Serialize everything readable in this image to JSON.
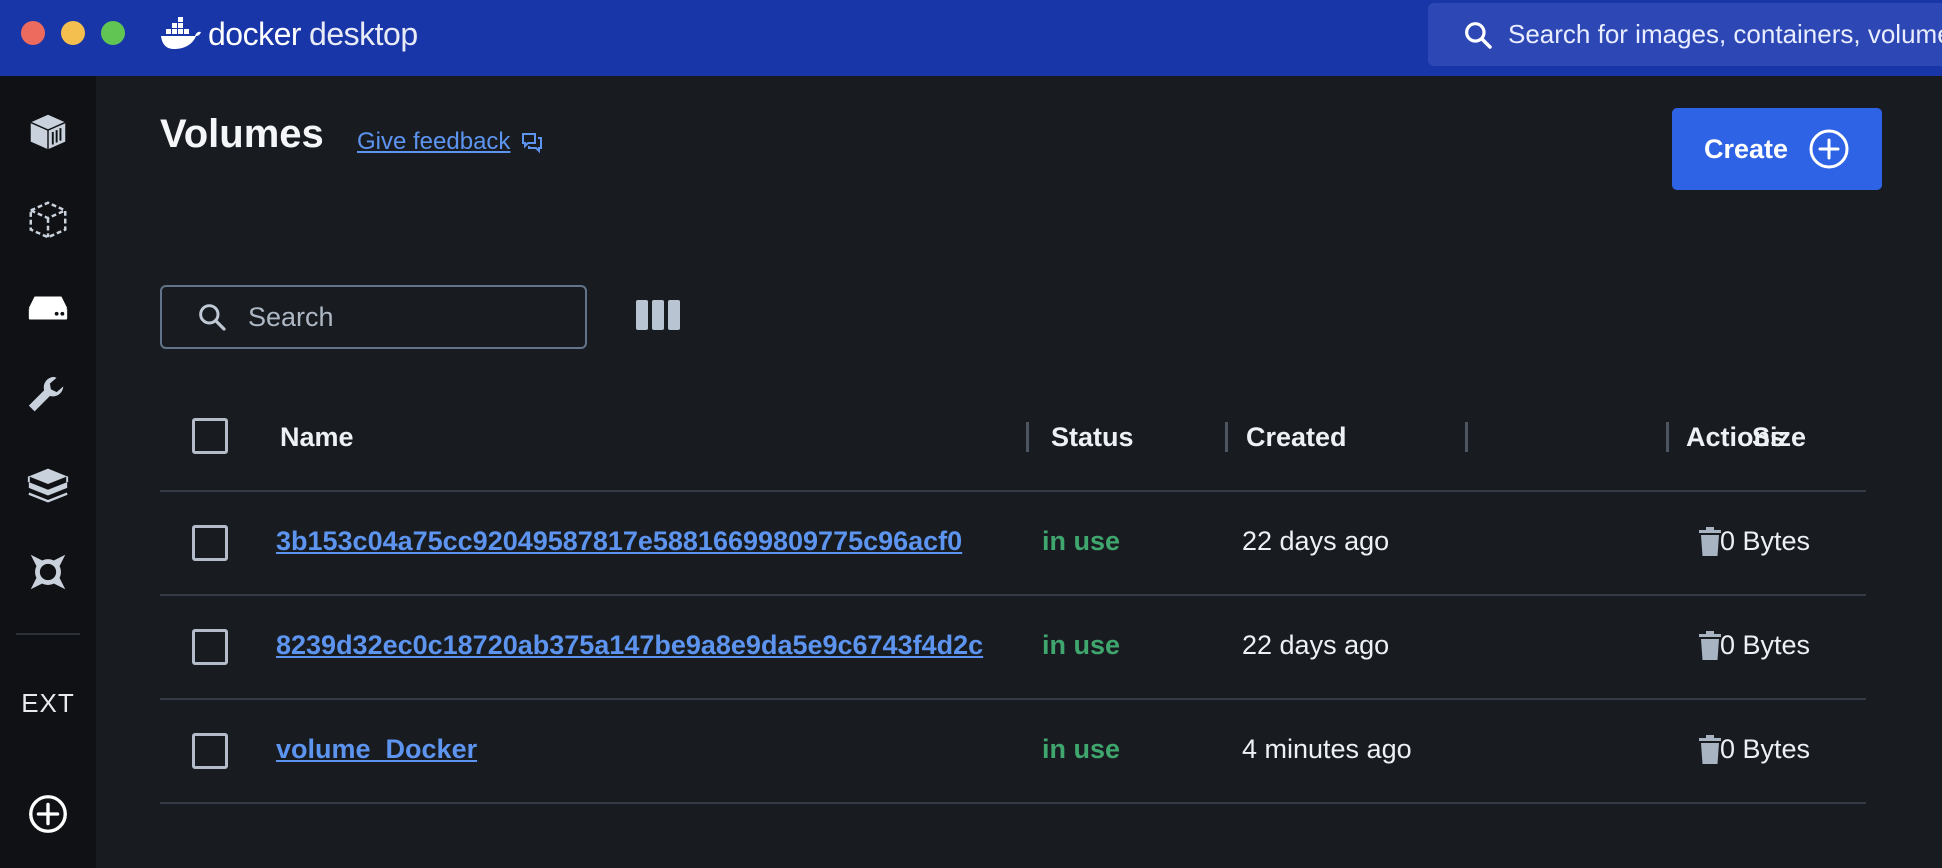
{
  "titlebar": {
    "brand_primary": "docker",
    "brand_secondary": "desktop",
    "search_placeholder": "Search for images, containers, volumes",
    "brand_color": "#1836a8"
  },
  "sidebar": {
    "items": [
      {
        "name": "containers",
        "icon": "container-icon"
      },
      {
        "name": "images",
        "icon": "image-icon"
      },
      {
        "name": "volumes",
        "icon": "volume-icon"
      },
      {
        "name": "dev-environments",
        "icon": "wrench-icon"
      },
      {
        "name": "docker-scout",
        "icon": "cube-icon"
      },
      {
        "name": "extensions-hub",
        "icon": "extension-icon"
      }
    ],
    "ext_label": "EXT",
    "add_extension_icon": "plus-circle-icon"
  },
  "header": {
    "title": "Volumes",
    "feedback_label": "Give feedback",
    "create_label": "Create"
  },
  "toolbar": {
    "search_placeholder": "Search"
  },
  "table": {
    "columns": [
      "Name",
      "Status",
      "Created",
      "Size",
      "Actions"
    ],
    "rows": [
      {
        "name": "3b153c04a75cc92049587817e58816699809775c96acf0",
        "status": "in use",
        "created": "22 days ago",
        "size": "0 Bytes"
      },
      {
        "name": "8239d32ec0c18720ab375a147be9a8e9da5e9c6743f4d2c",
        "status": "in use",
        "created": "22 days ago",
        "size": "0 Bytes"
      },
      {
        "name": "volume_Docker",
        "status": "in use",
        "created": "4 minutes ago",
        "size": "0 Bytes"
      }
    ]
  },
  "colors": {
    "accent": "#2e63e6",
    "link": "#5c94f0",
    "status_in_use": "#3fa66d",
    "background": "#181c21",
    "sidebar": "#0f1114"
  }
}
